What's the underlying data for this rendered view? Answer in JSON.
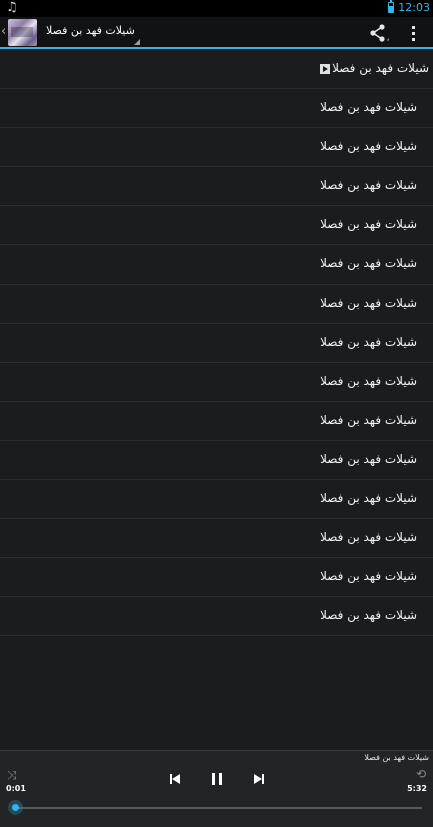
{
  "status_bar": {
    "notification_icon": "music-note-icon",
    "time": "12:03",
    "accent_color": "#33b5e5"
  },
  "action_bar": {
    "title": "شيلات فهد بن فصلا",
    "share_icon": "share-icon",
    "overflow_icon": "overflow-menu-icon"
  },
  "playlist": {
    "playing_index": 0,
    "items": [
      "شيلات فهد بن فصلا",
      "شيلات فهد بن فصلا",
      "شيلات فهد بن فصلا",
      "شيلات فهد بن فصلا",
      "شيلات فهد بن فصلا",
      "شيلات فهد بن فصلا",
      "شيلات فهد بن فصلا",
      "شيلات فهد بن فصلا",
      "شيلات فهد بن فصلا",
      "شيلات فهد بن فصلا",
      "شيلات فهد بن فصلا",
      "شيلات فهد بن فصلا",
      "شيلات فهد بن فصلا",
      "شيلات فهد بن فصلا",
      "شيلات فهد بن فصلا"
    ]
  },
  "player": {
    "now_playing": "شيلات فهد بن فصلا",
    "elapsed": "0:01",
    "duration": "5:32",
    "progress_fraction": 0.003,
    "shuffle_icon": "shuffle-icon",
    "repeat_icon": "repeat-icon",
    "prev_icon": "skip-previous-icon",
    "pause_icon": "pause-icon",
    "next_icon": "skip-next-icon"
  }
}
